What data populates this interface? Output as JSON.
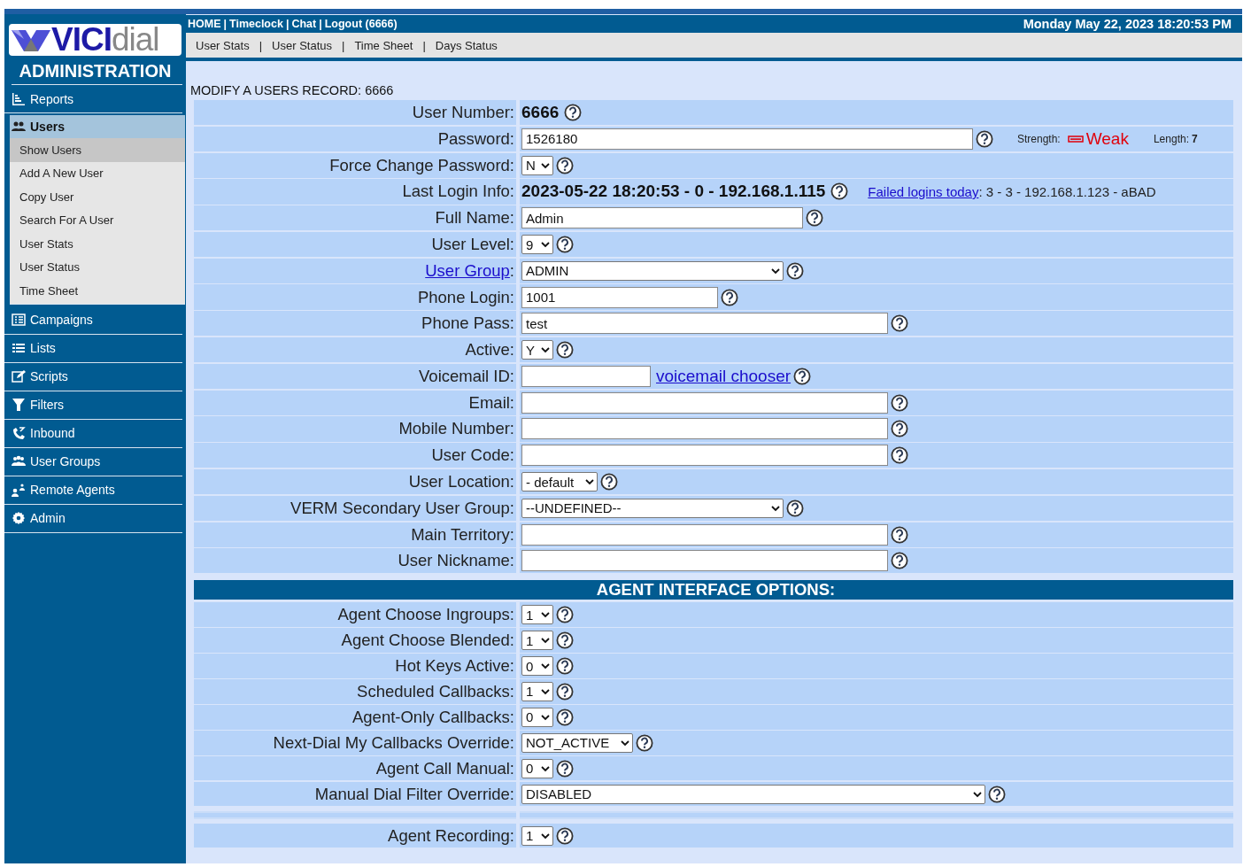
{
  "sidebar": {
    "logo": {
      "bold_part": "VICI",
      "light_part": "dial"
    },
    "section_title": "ADMINISTRATION",
    "nav": [
      {
        "label": "Reports",
        "expanded": false
      },
      {
        "label": "Users",
        "expanded": true,
        "children": [
          {
            "label": "Show Users",
            "selected": true
          },
          {
            "label": "Add A New User",
            "selected": false
          },
          {
            "label": "Copy User",
            "selected": false
          },
          {
            "label": "Search For A User",
            "selected": false
          },
          {
            "label": "User Stats",
            "selected": false
          },
          {
            "label": "User Status",
            "selected": false
          },
          {
            "label": "Time Sheet",
            "selected": false
          }
        ]
      },
      {
        "label": "Campaigns",
        "expanded": false
      },
      {
        "label": "Lists",
        "expanded": false
      },
      {
        "label": "Scripts",
        "expanded": false
      },
      {
        "label": "Filters",
        "expanded": false
      },
      {
        "label": "Inbound",
        "expanded": false
      },
      {
        "label": "User Groups",
        "expanded": false
      },
      {
        "label": "Remote Agents",
        "expanded": false
      },
      {
        "label": "Admin",
        "expanded": false
      }
    ]
  },
  "top_bar": {
    "links": [
      "HOME",
      "Timeclock",
      "Chat",
      "Logout (6666)"
    ],
    "separator": "|",
    "datetime": "Monday May 22, 2023 18:20:53 PM"
  },
  "sub_menu": {
    "links": [
      "User Stats",
      "User Status",
      "Time Sheet",
      "Days Status"
    ],
    "separator": "|"
  },
  "page_title": "MODIFY A USERS RECORD: 6666",
  "form_rows": [
    {
      "label": "User Number:",
      "kind": "static",
      "value": "6666"
    },
    {
      "label": "Password:",
      "kind": "input",
      "value": "1526180",
      "strength_label": "Strength:",
      "strength": "Weak",
      "length_label": "Length:",
      "length": "7"
    },
    {
      "label": "Force Change Password:",
      "kind": "select",
      "value": "N"
    },
    {
      "label": "Last Login Info:",
      "kind": "static",
      "value": "2023-05-22 18:20:53 - 0 - 192.168.1.115",
      "link": "Failed logins today",
      "after_link": ": 3 - 3 - 192.168.1.123 - aBAD"
    },
    {
      "label": "Full Name:",
      "kind": "input",
      "value": "Admin"
    },
    {
      "label": "User Level:",
      "kind": "select",
      "value": "9"
    },
    {
      "label": "User Group:",
      "kind": "select",
      "value": "ADMIN",
      "label_link": true
    },
    {
      "label": "Phone Login:",
      "kind": "input",
      "value": "1001"
    },
    {
      "label": "Phone Pass:",
      "kind": "input",
      "value": "test"
    },
    {
      "label": "Active:",
      "kind": "select",
      "value": "Y"
    },
    {
      "label": "Voicemail ID:",
      "kind": "input",
      "link": "voicemail chooser"
    },
    {
      "label": "Email:",
      "kind": "input"
    },
    {
      "label": "Mobile Number:",
      "kind": "input"
    },
    {
      "label": "User Code:",
      "kind": "input"
    },
    {
      "label": "User Location:",
      "kind": "select",
      "value": "- default"
    },
    {
      "label": "VERM Secondary User Group:",
      "kind": "select",
      "value": "--UNDEFINED--"
    },
    {
      "label": "Main Territory:",
      "kind": "input"
    },
    {
      "label": "User Nickname:",
      "kind": "input"
    }
  ],
  "agent_section": {
    "title": "AGENT INTERFACE OPTIONS:",
    "rows": [
      {
        "label": "Agent Choose Ingroups:",
        "kind": "select",
        "value": "1"
      },
      {
        "label": "Agent Choose Blended:",
        "kind": "select",
        "value": "1"
      },
      {
        "label": "Hot Keys Active:",
        "kind": "select",
        "value": "0"
      },
      {
        "label": "Scheduled Callbacks:",
        "kind": "select",
        "value": "1"
      },
      {
        "label": "Agent-Only Callbacks:",
        "kind": "select",
        "value": "0"
      },
      {
        "label": "Next-Dial My Callbacks Override:",
        "kind": "select",
        "value": "NOT_ACTIVE"
      },
      {
        "label": "Agent Call Manual:",
        "kind": "select",
        "value": "0"
      },
      {
        "label": "Manual Dial Filter Override:",
        "kind": "select",
        "value": "DISABLED"
      },
      {
        "kind": "blank"
      },
      {
        "label": "Agent Recording:",
        "kind": "select",
        "value": "1"
      }
    ]
  }
}
